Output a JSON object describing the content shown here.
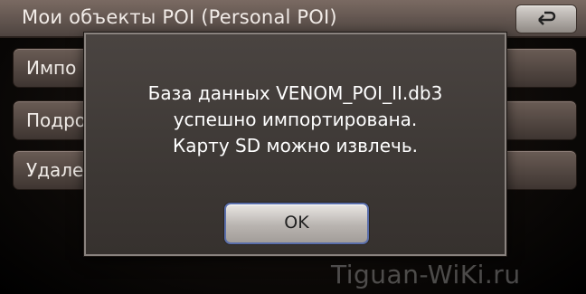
{
  "header": {
    "title": "Мои объекты POI (Personal POI)",
    "back_icon": "back-arrow-icon"
  },
  "list": {
    "items": [
      {
        "label": "Импо"
      },
      {
        "label": "Подро"
      },
      {
        "label": "Удале"
      }
    ]
  },
  "dialog": {
    "lines": [
      "База данных VENOM_POI_II.db3",
      "успешно импортирована.",
      "Карту SD можно извлечь."
    ],
    "ok_label": "OK"
  },
  "watermark": "Tiguan-WiKi.ru"
}
